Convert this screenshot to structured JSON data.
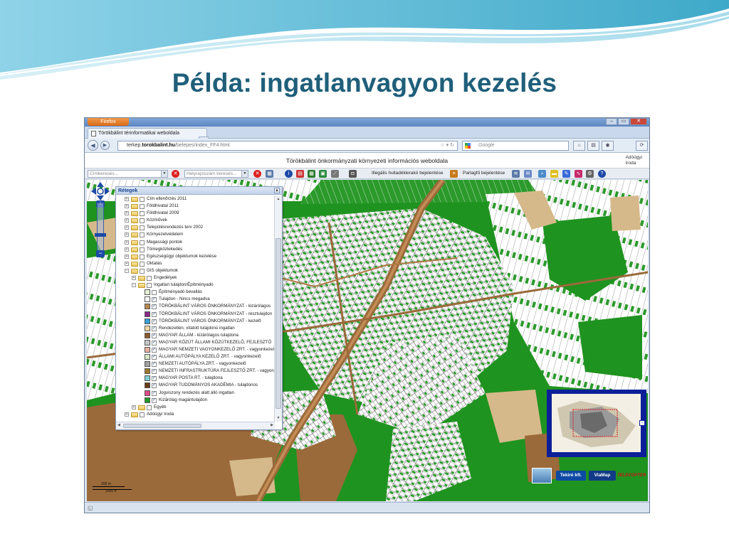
{
  "slide": {
    "title": "Példa: ingatlanvagyon kezelés"
  },
  "browser": {
    "app_button": "Firefox",
    "tab_title": "Törökbálint térinformatikai weboldala",
    "tab_new": "+",
    "url_prefix": "terkep.",
    "url_domain": "torokbalint.hu",
    "url_path": "/belepes/index_FF4.html",
    "search_placeholder": "Google",
    "win_minimize": "–",
    "win_maximize": "▭",
    "win_close": "✕"
  },
  "app": {
    "header_title": "Törökbálint önkormányzati környezeti információs weboldala",
    "header_right_line1": "Adóügyi",
    "header_right_line2": "Iroda",
    "address_placeholder": "Címkeresés...",
    "place_placeholder": "Helyrajzi­szám keresés...",
    "illegal_dump_label": "Illegális hulladéklerakó bejelentése",
    "fallow_label": "Parlagfű bejelentése"
  },
  "layers_panel": {
    "title": "Rétegek",
    "rows": [
      {
        "label": "Cím ellenőrzés 2011",
        "level": 0,
        "kind": "group",
        "expander": "+"
      },
      {
        "label": "Földhivatal 2011",
        "level": 0,
        "kind": "group",
        "expander": "+"
      },
      {
        "label": "Földhivatal 2009",
        "level": 0,
        "kind": "group",
        "expander": "+"
      },
      {
        "label": "Közművek",
        "level": 0,
        "kind": "group",
        "expander": "+"
      },
      {
        "label": "Településrendezés terv 2002",
        "level": 0,
        "kind": "group",
        "expander": "+"
      },
      {
        "label": "Környezetvédelem",
        "level": 0,
        "kind": "group",
        "expander": "+"
      },
      {
        "label": "Magassági pontok",
        "level": 0,
        "kind": "group",
        "expander": "+"
      },
      {
        "label": "Tömegközlekedés",
        "level": 0,
        "kind": "group",
        "expander": "+"
      },
      {
        "label": "Egészségügyi objektumok kezelése",
        "level": 0,
        "kind": "group",
        "expander": "+"
      },
      {
        "label": "Oktatás",
        "level": 0,
        "kind": "group",
        "expander": "+"
      },
      {
        "label": "GIS objektumok",
        "level": 0,
        "kind": "group",
        "expander": "−"
      },
      {
        "label": "Engedélyek",
        "level": 1,
        "kind": "group",
        "expander": "+"
      },
      {
        "label": "Ingatlan tulajdon/Építményadó",
        "level": 1,
        "kind": "group",
        "expander": "−"
      },
      {
        "label": "Építményadó bevallás",
        "level": 2,
        "kind": "leaf",
        "checked": false,
        "color": "#e6f2d4"
      },
      {
        "label": "Tulajdon - Nincs megadva",
        "level": 2,
        "kind": "leaf",
        "checked": true,
        "color": "#ffffff"
      },
      {
        "label": "TÖRÖKBÁLINT VÁROS ÖNKORMÁNYZAT - kizárólagos",
        "level": 2,
        "kind": "leaf",
        "checked": true,
        "color": "#b8864e"
      },
      {
        "label": "TÖRÖKBÁLINT VÁROS ÖNKORMÁNYZAT - résztulajdon",
        "level": 2,
        "kind": "leaf",
        "checked": true,
        "color": "#8a2a8a"
      },
      {
        "label": "TÖRÖKBÁLINT VÁROS ÖNKORMÁNYZAT - kezelő",
        "level": 2,
        "kind": "leaf",
        "checked": true,
        "color": "#3aa0d8"
      },
      {
        "label": "Rendezetlen, vitatott tulajdonú ingatlan",
        "level": 2,
        "kind": "leaf",
        "checked": true,
        "color": "#f2d9a4"
      },
      {
        "label": "MAGYAR ÁLLAM - kizárólagos tulajdona",
        "level": 2,
        "kind": "leaf",
        "checked": true,
        "color": "#8c5a2a"
      },
      {
        "label": "MAGYAR KÖZÚT ÁLLAMI KÖZÚTKEZELŐ, FEJLESZTŐ",
        "level": 2,
        "kind": "leaf",
        "checked": true,
        "color": "#c7c7c7"
      },
      {
        "label": "MAGYAR NEMZETI VAGYONKEZELŐ ZRT. - vagyonkezelő",
        "level": 2,
        "kind": "leaf",
        "checked": true,
        "color": "#e8b0a0"
      },
      {
        "label": "ÁLLAMI AUTÓPÁLYA KEZELŐ ZRT. - vagyonkezelő",
        "level": 2,
        "kind": "leaf",
        "checked": true,
        "color": "#d8e8c8"
      },
      {
        "label": "NEMZETI AUTÓPÁLYA ZRT. - vagyonkezelő",
        "level": 2,
        "kind": "leaf",
        "checked": true,
        "color": "#a0a0a0"
      },
      {
        "label": "NEMZETI INFRASTRUKTÚRA FEJLESZTŐ ZRT. - vagyonkezelő",
        "level": 2,
        "kind": "leaf",
        "checked": true,
        "color": "#a07a2a"
      },
      {
        "label": "MAGYAR POSTA RT. - tulajdona",
        "level": 2,
        "kind": "leaf",
        "checked": true,
        "color": "#7fcfd8"
      },
      {
        "label": "MAGYAR TUDOMÁNYOS AKADÉMIA - tulajdonos",
        "level": 2,
        "kind": "leaf",
        "checked": true,
        "color": "#6a3a1a"
      },
      {
        "label": "Jogviszony rendezés alatt álló ingatlan",
        "level": 2,
        "kind": "leaf",
        "checked": true,
        "color": "#e04a8a"
      },
      {
        "label": "Kizárólag magántulajdon",
        "level": 2,
        "kind": "leaf",
        "checked": true,
        "color": "#1f9a2a"
      },
      {
        "label": "Egyéb",
        "level": 1,
        "kind": "group",
        "expander": "+"
      },
      {
        "label": "Adóügyi Iroda",
        "level": 0,
        "kind": "group",
        "expander": "+"
      }
    ]
  },
  "scale": {
    "metric": "200 m",
    "imperial": "1000 ft"
  },
  "logos": {
    "tekire": "Tekiré kft.",
    "viamap": "ViaMap",
    "telecopter": "TELECOPTER"
  },
  "colors": {
    "title_color": "#1f5f7a",
    "map_green": "#1e8f1e",
    "map_brown": "#9a6a3a",
    "map_tan": "#d6b98a"
  },
  "icons": {
    "back": "left-arrow-icon",
    "forward": "right-arrow-icon",
    "reload": "reload-icon",
    "home": "home-icon",
    "help": "help-icon",
    "info": "info-icon"
  }
}
